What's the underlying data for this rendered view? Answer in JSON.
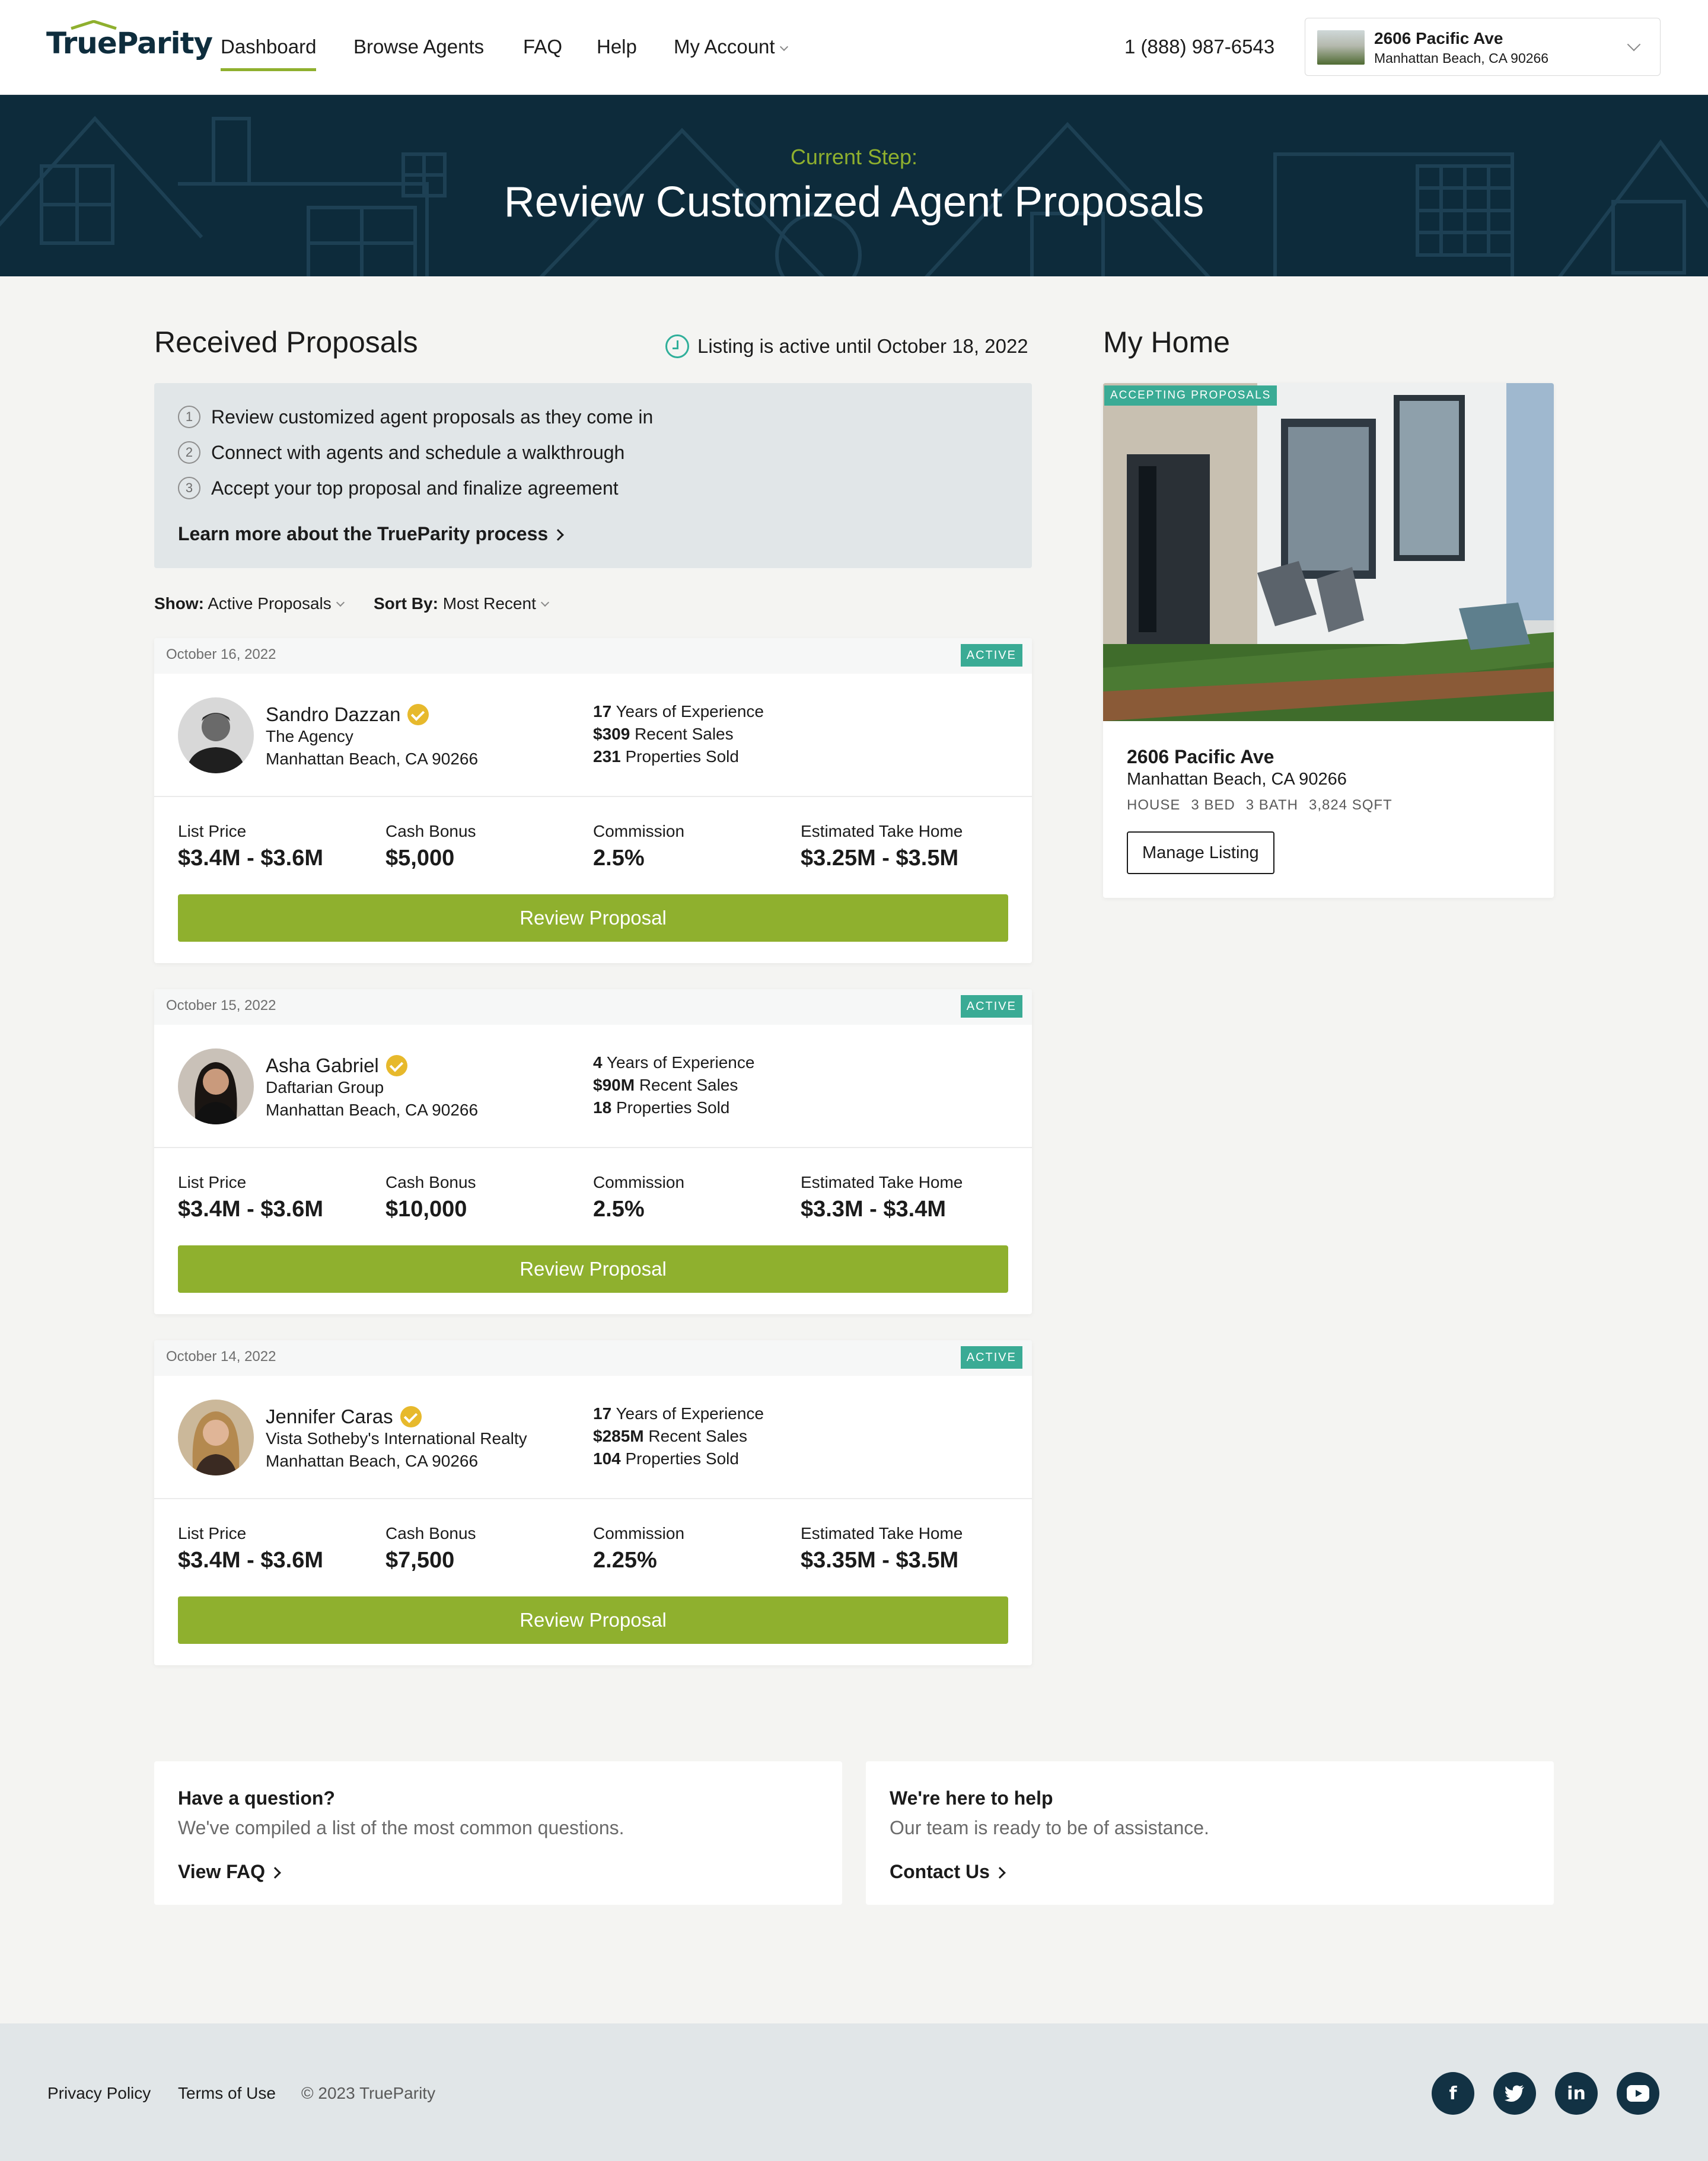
{
  "nav": {
    "logo": "TrueParity",
    "links": [
      "Dashboard",
      "Browse Agents",
      "FAQ",
      "Help",
      "My Account"
    ],
    "phone": "1 (888) 987-6543",
    "address": {
      "title": "2606 Pacific Ave",
      "sub": "Manhattan Beach, CA 90266"
    }
  },
  "hero": {
    "kicker": "Current Step:",
    "title": "Review Customized Agent Proposals"
  },
  "proposals_section": {
    "heading": "Received Proposals",
    "active_until": "Listing is active until October 18, 2022",
    "steps": [
      {
        "num": "1",
        "text": "Review customized agent proposals as they come in"
      },
      {
        "num": "2",
        "text": "Connect with agents and schedule a walkthrough"
      },
      {
        "num": "3",
        "text": "Accept your top proposal and finalize agreement"
      }
    ],
    "learn_more": "Learn more about the TrueParity process",
    "filters": {
      "show_label": "Show:",
      "show_value": "Active Proposals",
      "sort_label": "Sort By:",
      "sort_value": "Most Recent"
    }
  },
  "labels": {
    "list_price": "List Price",
    "cash_bonus": "Cash Bonus",
    "commission": "Commission",
    "take_home": "Estimated Take Home",
    "review_button": "Review Proposal",
    "years_suffix": "Years of Experience",
    "sales_suffix": "Recent Sales",
    "sold_suffix": "Properties Sold"
  },
  "proposals": [
    {
      "date": "October 16, 2022",
      "status": "ACTIVE",
      "name": "Sandro Dazzan",
      "company": "The Agency",
      "location": "Manhattan Beach, CA 90266",
      "years": "17",
      "sales": "$309",
      "sold": "231",
      "list_price": "$3.4M - $3.6M",
      "cash_bonus": "$5,000",
      "commission": "2.5%",
      "take_home": "$3.25M - $3.5M"
    },
    {
      "date": "October 15, 2022",
      "status": "ACTIVE",
      "name": "Asha Gabriel",
      "company": "Daftarian Group",
      "location": "Manhattan Beach, CA 90266",
      "years": "4",
      "sales": "$90M",
      "sold": "18",
      "list_price": "$3.4M - $3.6M",
      "cash_bonus": "$10,000",
      "commission": "2.5%",
      "take_home": "$3.3M - $3.4M"
    },
    {
      "date": "October 14, 2022",
      "status": "ACTIVE",
      "name": "Jennifer Caras",
      "company": "Vista Sotheby's International Realty",
      "location": "Manhattan Beach, CA 90266",
      "years": "17",
      "sales": "$285M",
      "sold": "104",
      "list_price": "$3.4M - $3.6M",
      "cash_bonus": "$7,500",
      "commission": "2.25%",
      "take_home": "$3.35M - $3.5M"
    }
  ],
  "my_home": {
    "heading": "My Home",
    "badge": "ACCEPTING PROPOSALS",
    "title": "2606 Pacific Ave",
    "sub": "Manhattan Beach, CA 90266",
    "specs": [
      "HOUSE",
      "3 BED",
      "3 BATH",
      "3,824 SQFT"
    ],
    "manage": "Manage Listing"
  },
  "help": [
    {
      "title": "Have a question?",
      "sub": "We've compiled a list of the most common questions.",
      "link": "View FAQ"
    },
    {
      "title": "We're here to help",
      "sub": "Our team is ready to be of assistance.",
      "link": "Contact Us"
    }
  ],
  "footer": {
    "privacy": "Privacy Policy",
    "terms": "Terms of Use",
    "copyright": "© 2023 TrueParity",
    "social": [
      "f",
      "t",
      "in",
      "▶"
    ]
  },
  "colors": {
    "navy": "#0d2b3b",
    "green": "#8fb02e",
    "teal": "#3aab95",
    "gold": "#e7b92c"
  }
}
